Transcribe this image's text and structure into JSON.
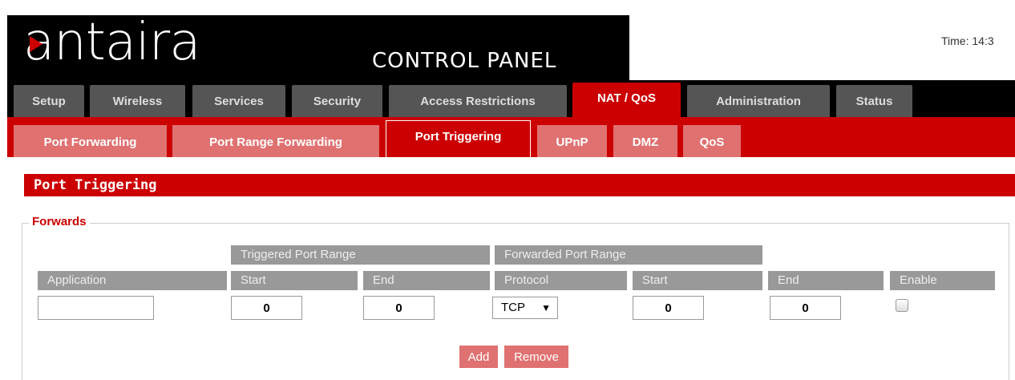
{
  "header": {
    "logo_text": "antaira",
    "title": "CONTROL PANEL",
    "time": "Time: 14:3"
  },
  "main_tabs": [
    "Setup",
    "Wireless",
    "Services",
    "Security",
    "Access Restrictions",
    "NAT / QoS",
    "Administration",
    "Status"
  ],
  "sub_tabs": [
    "Port Forwarding",
    "Port Range Forwarding",
    "Port Triggering",
    "UPnP",
    "DMZ",
    "QoS"
  ],
  "section": {
    "title": "Port Triggering",
    "legend": "Forwards"
  },
  "table": {
    "group_headers": [
      "Triggered Port Range",
      "Forwarded Port Range"
    ],
    "columns": [
      "Application",
      "Start",
      "End",
      "Protocol",
      "Start",
      "End",
      "Enable"
    ],
    "row": {
      "application": "",
      "triggered_start": "0",
      "triggered_end": "0",
      "protocol": "TCP",
      "forwarded_start": "0",
      "forwarded_end": "0",
      "enable": false
    }
  },
  "buttons": {
    "add": "Add",
    "remove": "Remove"
  },
  "colors": {
    "accent": "#cc0000",
    "inactive_tab": "#555555",
    "inactive_subtab": "#e07171",
    "header_gray": "#999999"
  }
}
